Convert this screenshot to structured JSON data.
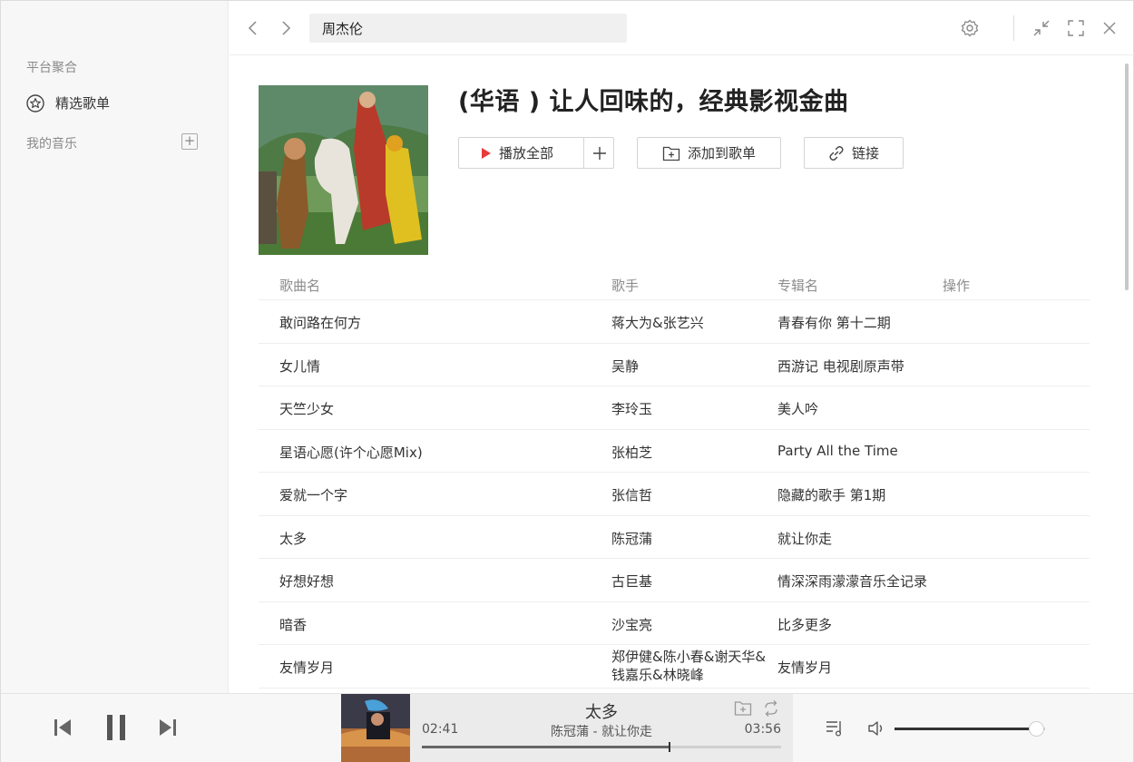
{
  "sidebar": {
    "group_platform": "平台聚合",
    "featured_playlists": "精选歌单",
    "group_my_music": "我的音乐"
  },
  "topbar": {
    "search_value": "周杰伦"
  },
  "playlist": {
    "title": "(华语 ) 让人回味的，经典影视金曲",
    "play_all": "播放全部",
    "add_to_playlist": "添加到歌单",
    "link": "链接"
  },
  "table": {
    "headers": {
      "song": "歌曲名",
      "artist": "歌手",
      "album": "专辑名",
      "action": "操作"
    },
    "rows": [
      {
        "song": "敢问路在何方",
        "artist": "蒋大为&张艺兴",
        "album": "青春有你 第十二期"
      },
      {
        "song": "女儿情",
        "artist": "吴静",
        "album": "西游记 电视剧原声带"
      },
      {
        "song": "天竺少女",
        "artist": "李玲玉",
        "album": "美人吟"
      },
      {
        "song": "星语心愿(许个心愿Mix)",
        "artist": "张柏芝",
        "album": "Party All the Time"
      },
      {
        "song": "爱就一个字",
        "artist": "张信哲",
        "album": "隐藏的歌手 第1期"
      },
      {
        "song": "太多",
        "artist": "陈冠蒲",
        "album": "就让你走"
      },
      {
        "song": "好想好想",
        "artist": "古巨基",
        "album": "情深深雨濛濛音乐全记录"
      },
      {
        "song": "暗香",
        "artist": "沙宝亮",
        "album": "比多更多"
      },
      {
        "song": "友情岁月",
        "artist": "郑伊健&陈小春&谢天华&钱嘉乐&林晓峰",
        "album": "友情岁月"
      }
    ]
  },
  "player": {
    "title": "太多",
    "subtitle": "陈冠蒲 - 就让你走",
    "current_time": "02:41",
    "total_time": "03:56",
    "progress": 0.69,
    "volume": 0.94
  },
  "icons": {
    "back": "chevron-left-icon",
    "forward": "chevron-right-icon",
    "settings": "gear-icon",
    "minimize": "shrink-icon",
    "maximize": "fullscreen-icon",
    "close": "close-icon",
    "star": "star-icon",
    "play": "play-icon",
    "prev": "skip-previous-icon",
    "pause": "pause-icon",
    "next": "skip-next-icon",
    "queue": "playlist-icon",
    "volume": "speaker-icon"
  },
  "colors": {
    "accent": "#e83a3a",
    "sidebar_bg": "#f7f7f7",
    "player_bg": "#f7f7f7"
  }
}
